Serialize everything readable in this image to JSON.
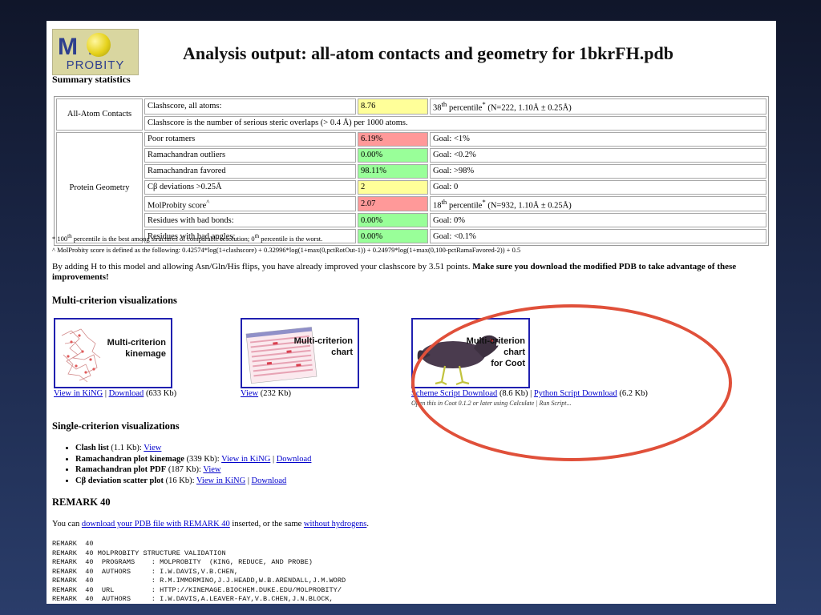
{
  "logo": {
    "letters": "M L",
    "word": "PROBITY"
  },
  "title": "Analysis output: all-atom contacts and geometry for 1bkrFH.pdb",
  "summary_heading": "Summary statistics",
  "table": {
    "contacts_group": "All-Atom Contacts",
    "geometry_group": "Protein Geometry",
    "clashscore": {
      "label": "Clashscore, all atoms:",
      "value": "8.76",
      "pct": "38",
      "pct_sup": "th",
      "pct_rest": " percentile",
      "pct_tail": " (N=222, 1.10Å ± 0.25Å)"
    },
    "clash_note": "Clashscore is the number of serious steric overlaps (> 0.4 Å) per 1000 atoms.",
    "rows": [
      {
        "label": "Poor rotamers",
        "value": "6.19%",
        "goal": "Goal: <1%",
        "color": "#ff9999"
      },
      {
        "label": "Ramachandran outliers",
        "value": "0.00%",
        "goal": "Goal: <0.2%",
        "color": "#99ff99"
      },
      {
        "label": "Ramachandran favored",
        "value": "98.11%",
        "goal": "Goal: >98%",
        "color": "#99ff99"
      },
      {
        "label": "Cβ deviations >0.25Å",
        "value": "2",
        "goal": "Goal: 0",
        "color": "#ffff99"
      }
    ],
    "molprobity": {
      "label": "MolProbity score",
      "value": "2.07",
      "pct": "18",
      "pct_sup": "th",
      "pct_rest": " percentile",
      "pct_tail": " (N=932, 1.10Å ± 0.25Å)"
    },
    "rows2": [
      {
        "label": "Residues with bad bonds:",
        "value": "0.00%",
        "goal": "Goal: 0%",
        "color": "#99ff99"
      },
      {
        "label": "Residues with bad angles:",
        "value": "0.00%",
        "goal": "Goal: <0.1%",
        "color": "#99ff99"
      }
    ]
  },
  "notes": {
    "n1a": "* 100",
    "n1b": "th",
    "n1c": " percentile is the best among structures of comparable resolution; 0",
    "n1d": "th",
    "n1e": " percentile is the worst.",
    "n2": "^ MolProbity score is defined as the following: 0.42574*log(1+clashscore) + 0.32996*log(1+max(0,pctRotOut-1)) + 0.24979*log(1+max(0,100-pctRamaFavored-2)) + 0.5"
  },
  "para": {
    "normal": "By adding H to this model and allowing Asn/Gln/His flips, you have already improved your clashscore by 3.51 points. ",
    "bold": "Make sure you download the modified PDB to take advantage of these improvements!"
  },
  "multi_heading": "Multi-criterion visualizations",
  "multi": {
    "kin_label_1": "Multi-criterion",
    "kin_label_2": "kinemage",
    "kin_view": "View in KiNG",
    "kin_download": "Download",
    "kin_size": " (633 Kb)",
    "chart_label_1": "Multi-criterion",
    "chart_label_2": "chart",
    "chart_view": "View",
    "chart_size": " (232 Kb)",
    "coot_label_1": "Multi-criterion",
    "coot_label_2": "chart",
    "coot_label_3": "for Coot",
    "coot_scheme": "Scheme Script Download",
    "coot_scheme_size": " (8.6 Kb) | ",
    "coot_python": "Python Script Download",
    "coot_python_size": " (6.2 Kb)",
    "coot_sub": "Open this in Coot 0.1.2 or later using Calculate | Run Script..."
  },
  "single_heading": "Single-criterion visualizations",
  "single": [
    {
      "bold": "Clash list",
      "rest": " (1.1 Kb): ",
      "link1": "View",
      "link2": ""
    },
    {
      "bold": "Ramachandran plot kinemage",
      "rest": " (339 Kb): ",
      "link1": "View in KiNG",
      "link2": "Download"
    },
    {
      "bold": "Ramachandran plot PDF",
      "rest": " (187 Kb): ",
      "link1": "View",
      "link2": ""
    },
    {
      "bold": "Cβ deviation scatter plot",
      "rest": " (16 Kb): ",
      "link1": "View in KiNG",
      "link2": "Download"
    }
  ],
  "remark_heading": "REMARK 40",
  "youcan": {
    "a": "You can ",
    "link1": "download your PDB file with REMARK 40",
    "b": " inserted, or the same ",
    "link2": "without hydrogens",
    "c": "."
  },
  "remark_lines": [
    "REMARK  40",
    "REMARK  40 MOLPROBITY STRUCTURE VALIDATION",
    "REMARK  40  PROGRAMS    : MOLPROBITY  (KING, REDUCE, AND PROBE)",
    "REMARK  40  AUTHORS     : I.W.DAVIS,V.B.CHEN,",
    "REMARK  40              : R.M.IMMORMINO,J.J.HEADD,W.B.ARENDALL,J.M.WORD",
    "REMARK  40  URL         : HTTP://KINEMAGE.BIOCHEM.DUKE.EDU/MOLPROBITY/",
    "REMARK  40  AUTHORS     : I.W.DAVIS,A.LEAVER-FAY,V.B.CHEN,J.N.BLOCK,"
  ],
  "colors": {
    "yellow": "#ffff99",
    "green": "#99ff99",
    "red": "#ff9999",
    "link": "#0000cc",
    "oval": "#e0503a"
  }
}
